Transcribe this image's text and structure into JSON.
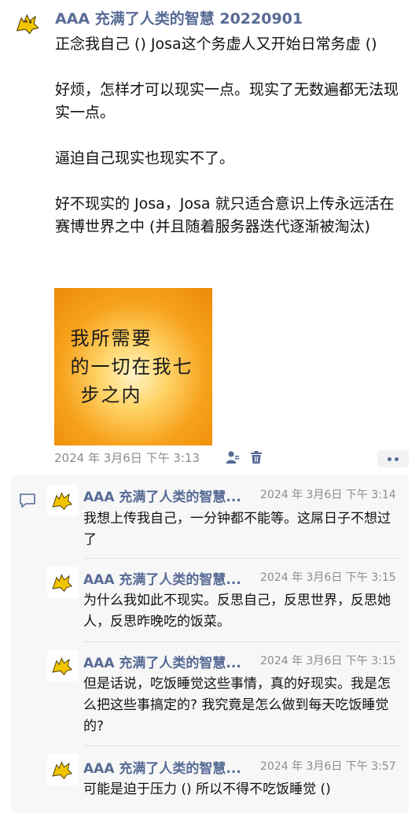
{
  "post": {
    "author": "AAA 充满了人类的智慧 20220901",
    "paragraphs": [
      "正念我自己 () Josa这个务虚人又开始日常务虚 ()",
      "",
      "好烦，怎样才可以现实一点。现实了无数遍都无法现实一点。",
      "",
      "逼迫自己现实也现实不了。",
      "",
      "好不现实的 Josa，Josa 就只适合意识上传永远活在赛博世界之中 (并且随着服务器迭代逐渐被淘汰)"
    ],
    "image_text": [
      "我所需要",
      "的一切在我七",
      "步之内"
    ],
    "timestamp": "2024 年 3月6日 下午 3:13",
    "icons": {
      "visibility": "user-icon",
      "delete": "trash-icon",
      "more": "more-dots-icon"
    }
  },
  "colors": {
    "name_link": "#576b95",
    "meta_grey": "#8c8c8c",
    "comment_bg": "#f7f7f7",
    "image_orange": "#f7a21c"
  },
  "comments_icon": "comment-bubble-icon",
  "comments": [
    {
      "author": "AAA 充满了人类的智慧...",
      "time": "2024 年 3月6日 下午 3:14",
      "text": "我想上传我自己，一分钟都不能等。这屌日子不想过了"
    },
    {
      "author": "AAA 充满了人类的智慧...",
      "time": "2024 年 3月6日 下午 3:15",
      "text": "为什么我如此不现实。反思自己，反思世界，反思她人，反思昨晚吃的饭菜。"
    },
    {
      "author": "AAA 充满了人类的智慧...",
      "time": "2024 年 3月6日 下午 3:15",
      "text": "但是话说，吃饭睡觉这些事情，真的好现实。我是怎么把这些事搞定的? 我究竟是怎么做到每天吃饭睡觉的?"
    },
    {
      "author": "AAA 充满了人类的智慧...",
      "time": "2024 年 3月6日 下午 3:57",
      "text": "可能是迫于压力 () 所以不得不吃饭睡觉 ()"
    }
  ]
}
